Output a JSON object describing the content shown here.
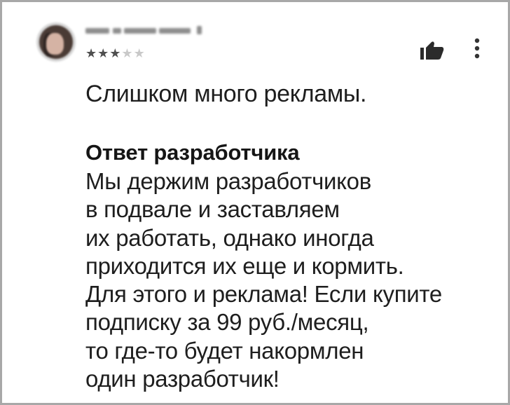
{
  "review": {
    "author": {
      "avatar_icon": "user-avatar-blurred",
      "name_hidden": true
    },
    "rating": {
      "stars": 3,
      "max": 5
    },
    "actions": {
      "helpful_icon": "thumbs-up-icon",
      "more_icon": "more-vert-icon"
    },
    "text": "Слишком много рекламы."
  },
  "developer_reply": {
    "title": "Ответ разработчика",
    "lines": [
      "Мы держим разработчиков",
      "в подвале и заставляем",
      "их работать, однако иногда",
      "приходится их еще и кормить.",
      "Для этого и реклама! Если купите",
      "подписку за 99 руб./месяц,",
      "то где-то будет накормлен",
      "один разработчик!"
    ]
  },
  "colors": {
    "border": "#a8a8a8",
    "text": "#1e1e1e",
    "star_full": "#4f4f4f",
    "star_empty": "#c9c9c9"
  }
}
